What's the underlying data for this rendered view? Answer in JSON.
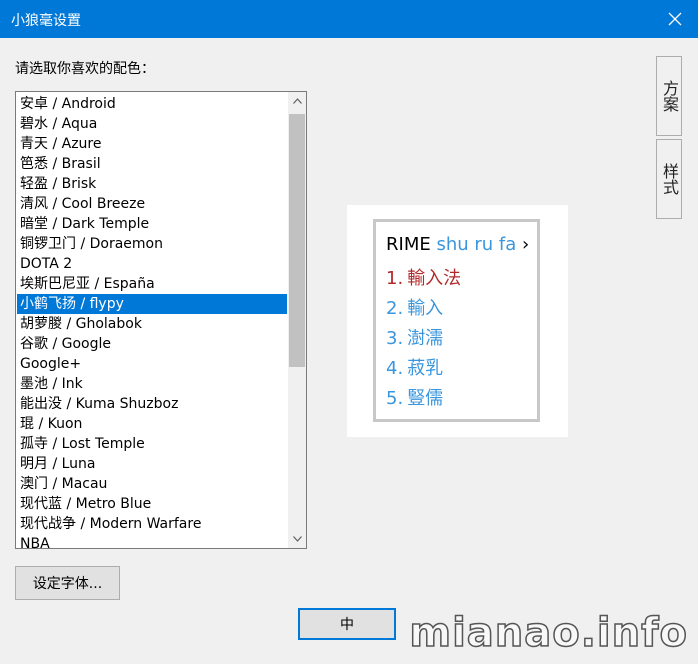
{
  "window": {
    "title": "小狼毫设置"
  },
  "prompt": "请选取你喜欢的配色：",
  "schemes": [
    "安卓 / Android",
    "碧水 / Aqua",
    "青天 / Azure",
    "笆悉 / Brasil",
    "轻盈 / Brisk",
    "清风 / Cool Breeze",
    "暗堂 / Dark Temple",
    "铜锣卫门 / Doraemon",
    "DOTA 2",
    "埃斯巴尼亚 / España",
    "小鹤飞扬 / flypy",
    "胡萝朡 / Gholabok",
    "谷歌 / Google",
    "Google+",
    "墨池 / Ink",
    "能出没 / Kuma Shuzboz",
    "琨 / Kuon",
    "孤寺 / Lost Temple",
    "明月 / Luna",
    "澳门 / Macau",
    "现代蓝 / Metro Blue",
    "现代战争 / Modern Warfare",
    "NBA"
  ],
  "selected_index": 10,
  "side_tabs": [
    "方案",
    "样式"
  ],
  "preview": {
    "preedit": "RIME",
    "pinyin": "shu ru fa",
    "arrow": "›",
    "candidates": [
      {
        "label": "1.",
        "text": "輸入法"
      },
      {
        "label": "2.",
        "text": "輸入"
      },
      {
        "label": "3.",
        "text": "澍濡"
      },
      {
        "label": "4.",
        "text": "菽乳"
      },
      {
        "label": "5.",
        "text": "豎儒"
      }
    ],
    "colors": {
      "highlight": "#b02a2a",
      "normal": "#3a96dd",
      "text": "#000000"
    }
  },
  "buttons": {
    "font": "设定字体...",
    "ok": "中"
  },
  "watermark": "mianao.info"
}
